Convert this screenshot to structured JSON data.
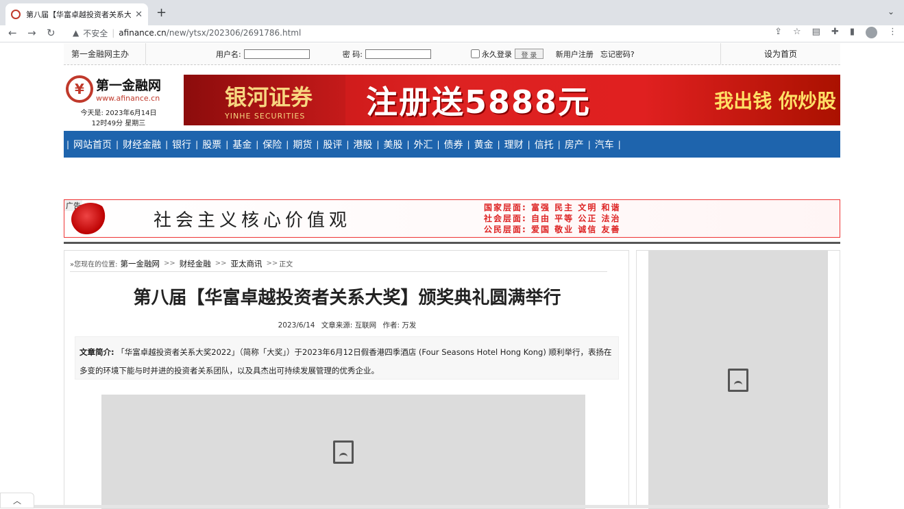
{
  "browser": {
    "tab_title": "第八届【华富卓越投资者关系大奖】",
    "new_tab": "+",
    "tab_menu": "⌄",
    "security_label": "不安全",
    "url_host": "afinance.cn",
    "url_path": "/new/ytsx/202306/2691786.html"
  },
  "topbar": {
    "host": "第一金融网主办",
    "username_label": "用户名:",
    "password_label": "密  码:",
    "remember": "永久登录",
    "login": "登 录",
    "register": "新用户注册",
    "forgot": "忘记密码?",
    "sethome": "设为首页"
  },
  "header": {
    "logo_cn": "第一金融网",
    "logo_en": "www.afinance.cn",
    "date_line1": "今天是:  2023年6月14日",
    "date_line2": "12时49分  星期三",
    "banner_brand": "银河证券",
    "banner_brand_en": "YINHE SECURITIES",
    "banner_promo": "注册送5888元",
    "banner_slogan": "我出钱 你炒股"
  },
  "nav": {
    "items": [
      "网站首页",
      "财经金融",
      "银行",
      "股票",
      "基金",
      "保险",
      "期货",
      "股评",
      "港股",
      "美股",
      "外汇",
      "债券",
      "黄金",
      "理财",
      "信托",
      "房产",
      "汽车"
    ]
  },
  "ad": {
    "tag": "广告",
    "core": "社会主义核心价值观",
    "line1": "国家层面: 富强  民主  文明  和谐",
    "line2": "社会层面: 自由  平等  公正  法治",
    "line3": "公民层面: 爱国  敬业  诚信  友善"
  },
  "article": {
    "crumb_prefix": "»您现在的位置:",
    "crumb_1": "第一金融网",
    "crumb_2": "财经金融",
    "crumb_3": "亚太商讯",
    "crumb_4": "正文",
    "crumb_sep": ">>",
    "title": "第八届【华富卓越投资者关系大奖】颁奖典礼圆满举行",
    "date": "2023/6/14",
    "source": "文章来源: 互联网",
    "author": "作者: 万发",
    "summary_label": "文章简介:",
    "summary_text": "「华富卓越投资者关系大奖2022」（简称「大奖」）于2023年6月12日假香港四季酒店 (Four Seasons Hotel Hong Kong) 顺利举行，表扬在多变的环境下能与时并进的投资者关系团队，以及具杰出可持续发展管理的优秀企业。"
  }
}
